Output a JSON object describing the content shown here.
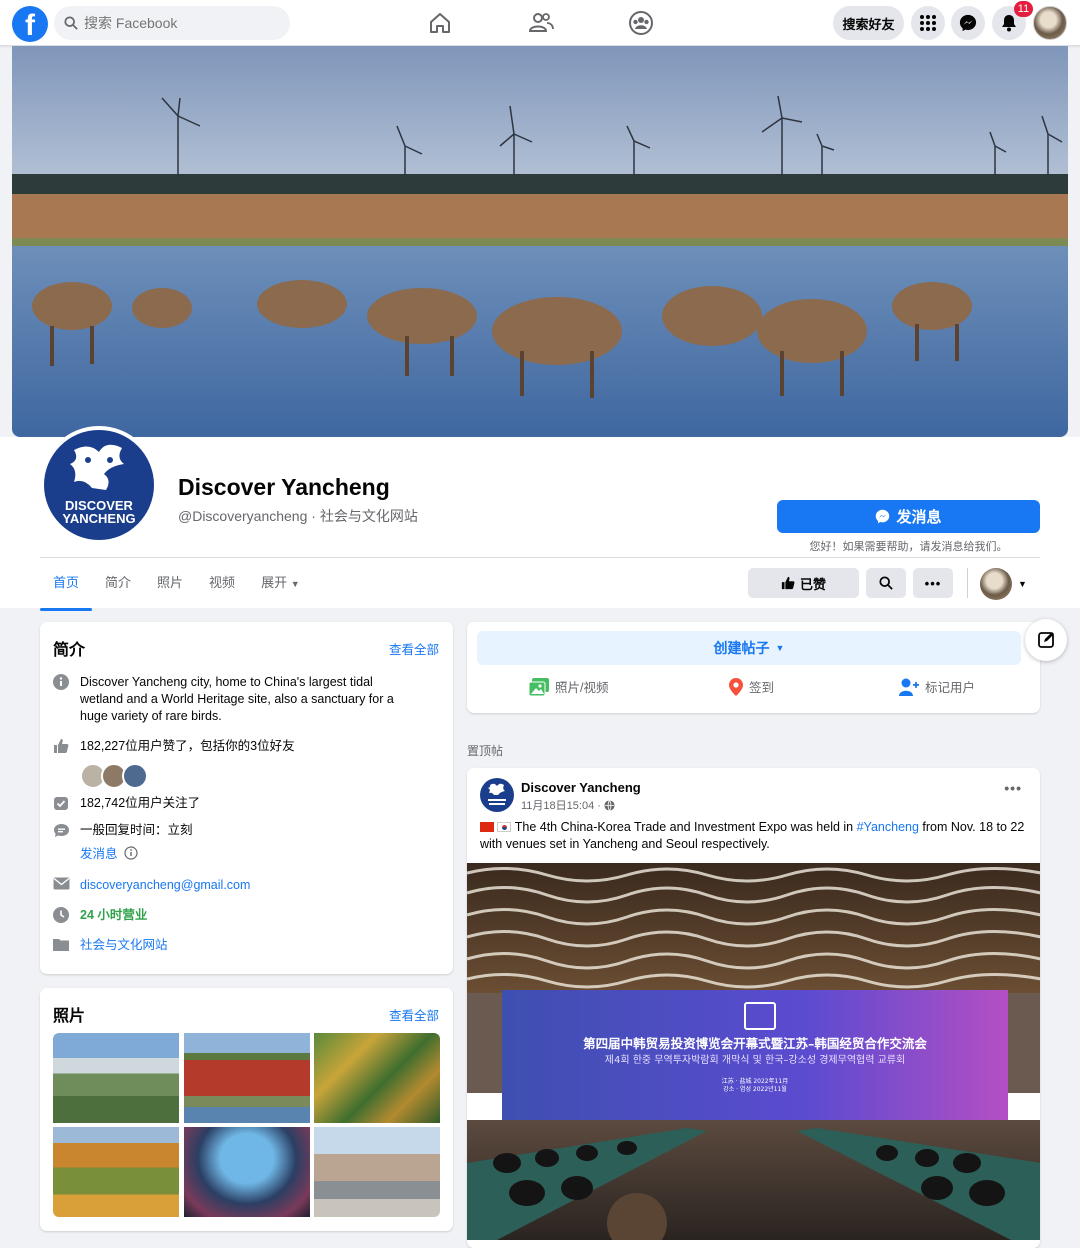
{
  "topbar": {
    "logo_letter": "f",
    "search_placeholder": "搜索 Facebook",
    "find_friends": "搜索好友",
    "notification_count": "11"
  },
  "page": {
    "name": "Discover Yancheng",
    "handle_category": "@Discoveryancheng · 社会与文化网站",
    "logo_text_line1": "DISCOVER",
    "logo_text_line2": "YANCHENG",
    "message_button": "发消息",
    "message_note": "您好！如果需要帮助，请发消息给我们。"
  },
  "tabs": [
    {
      "label": "首页",
      "active": true
    },
    {
      "label": "简介",
      "active": false
    },
    {
      "label": "照片",
      "active": false
    },
    {
      "label": "视频",
      "active": false
    },
    {
      "label": "展开",
      "active": false
    }
  ],
  "actions": {
    "liked_label": "已赞"
  },
  "intro": {
    "title": "简介",
    "see_all": "查看全部",
    "description": "Discover Yancheng city, home to China's largest tidal wetland and a World Heritage site, also a sanctuary for a huge variety of rare birds.",
    "likes": "182,227位用户赞了，包括你的3位好友",
    "followers": "182,742位用户关注了",
    "response_time": "一般回复时间：立刻",
    "send_message_link": "发消息",
    "email": "discoveryancheng@gmail.com",
    "hours": "24 小时营业",
    "category": "社会与文化网站"
  },
  "photos": {
    "title": "照片",
    "see_all": "查看全部"
  },
  "composer": {
    "create_post": "创建帖子",
    "photo_video": "照片/视频",
    "check_in": "签到",
    "tag_people": "标记用户"
  },
  "pinned_label": "置顶帖",
  "post": {
    "author": "Discover Yancheng",
    "time": "11月18日15:04 · ",
    "text_before": " The 4th China-Korea Trade and Investment Expo was held in ",
    "hashtag": "#Yancheng",
    "text_after": " from Nov. 18 to 22 with venues set in Yancheng and Seoul respectively.",
    "banner_line1": "第四届中韩贸易投资博览会开幕式暨江苏–韩国经贸合作交流会",
    "banner_line2": "제4회 한중 무역투자박람회 개막식 및 한국–강소성 경제무역협력 교류회",
    "banner_line3": "江苏 · 盐城 2022年11月",
    "banner_line4": "강소 · 염성 2022년11월"
  }
}
